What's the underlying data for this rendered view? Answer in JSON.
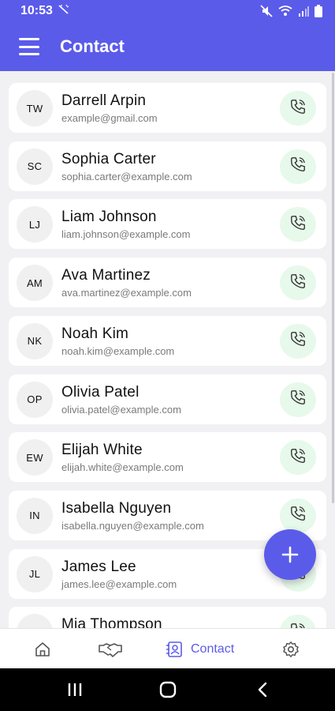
{
  "status_bar": {
    "time": "10:53"
  },
  "app_bar": {
    "title": "Contact"
  },
  "contacts": [
    {
      "initials": "TW",
      "name": "Darrell Arpin",
      "email": "example@gmail.com"
    },
    {
      "initials": "SC",
      "name": "Sophia Carter",
      "email": "sophia.carter@example.com"
    },
    {
      "initials": "LJ",
      "name": "Liam Johnson",
      "email": "liam.johnson@example.com"
    },
    {
      "initials": "AM",
      "name": "Ava Martinez",
      "email": "ava.martinez@example.com"
    },
    {
      "initials": "NK",
      "name": "Noah Kim",
      "email": "noah.kim@example.com"
    },
    {
      "initials": "OP",
      "name": "Olivia Patel",
      "email": "olivia.patel@example.com"
    },
    {
      "initials": "EW",
      "name": "Elijah White",
      "email": "elijah.white@example.com"
    },
    {
      "initials": "IN",
      "name": "Isabella Nguyen",
      "email": "isabella.nguyen@example.com"
    },
    {
      "initials": "JL",
      "name": "James Lee",
      "email": "james.lee@example.com"
    },
    {
      "initials": "",
      "name": "Mia Thompson",
      "email": ""
    }
  ],
  "bottom_nav": {
    "items": [
      {
        "icon": "home-icon",
        "label": ""
      },
      {
        "icon": "handshake-icon",
        "label": ""
      },
      {
        "icon": "contact-icon",
        "label": "Contact"
      },
      {
        "icon": "gear-icon",
        "label": ""
      }
    ],
    "active_index": 2
  },
  "colors": {
    "primary": "#5b5bea",
    "call_bg": "#e7f9ea",
    "background": "#f1f1f3"
  }
}
